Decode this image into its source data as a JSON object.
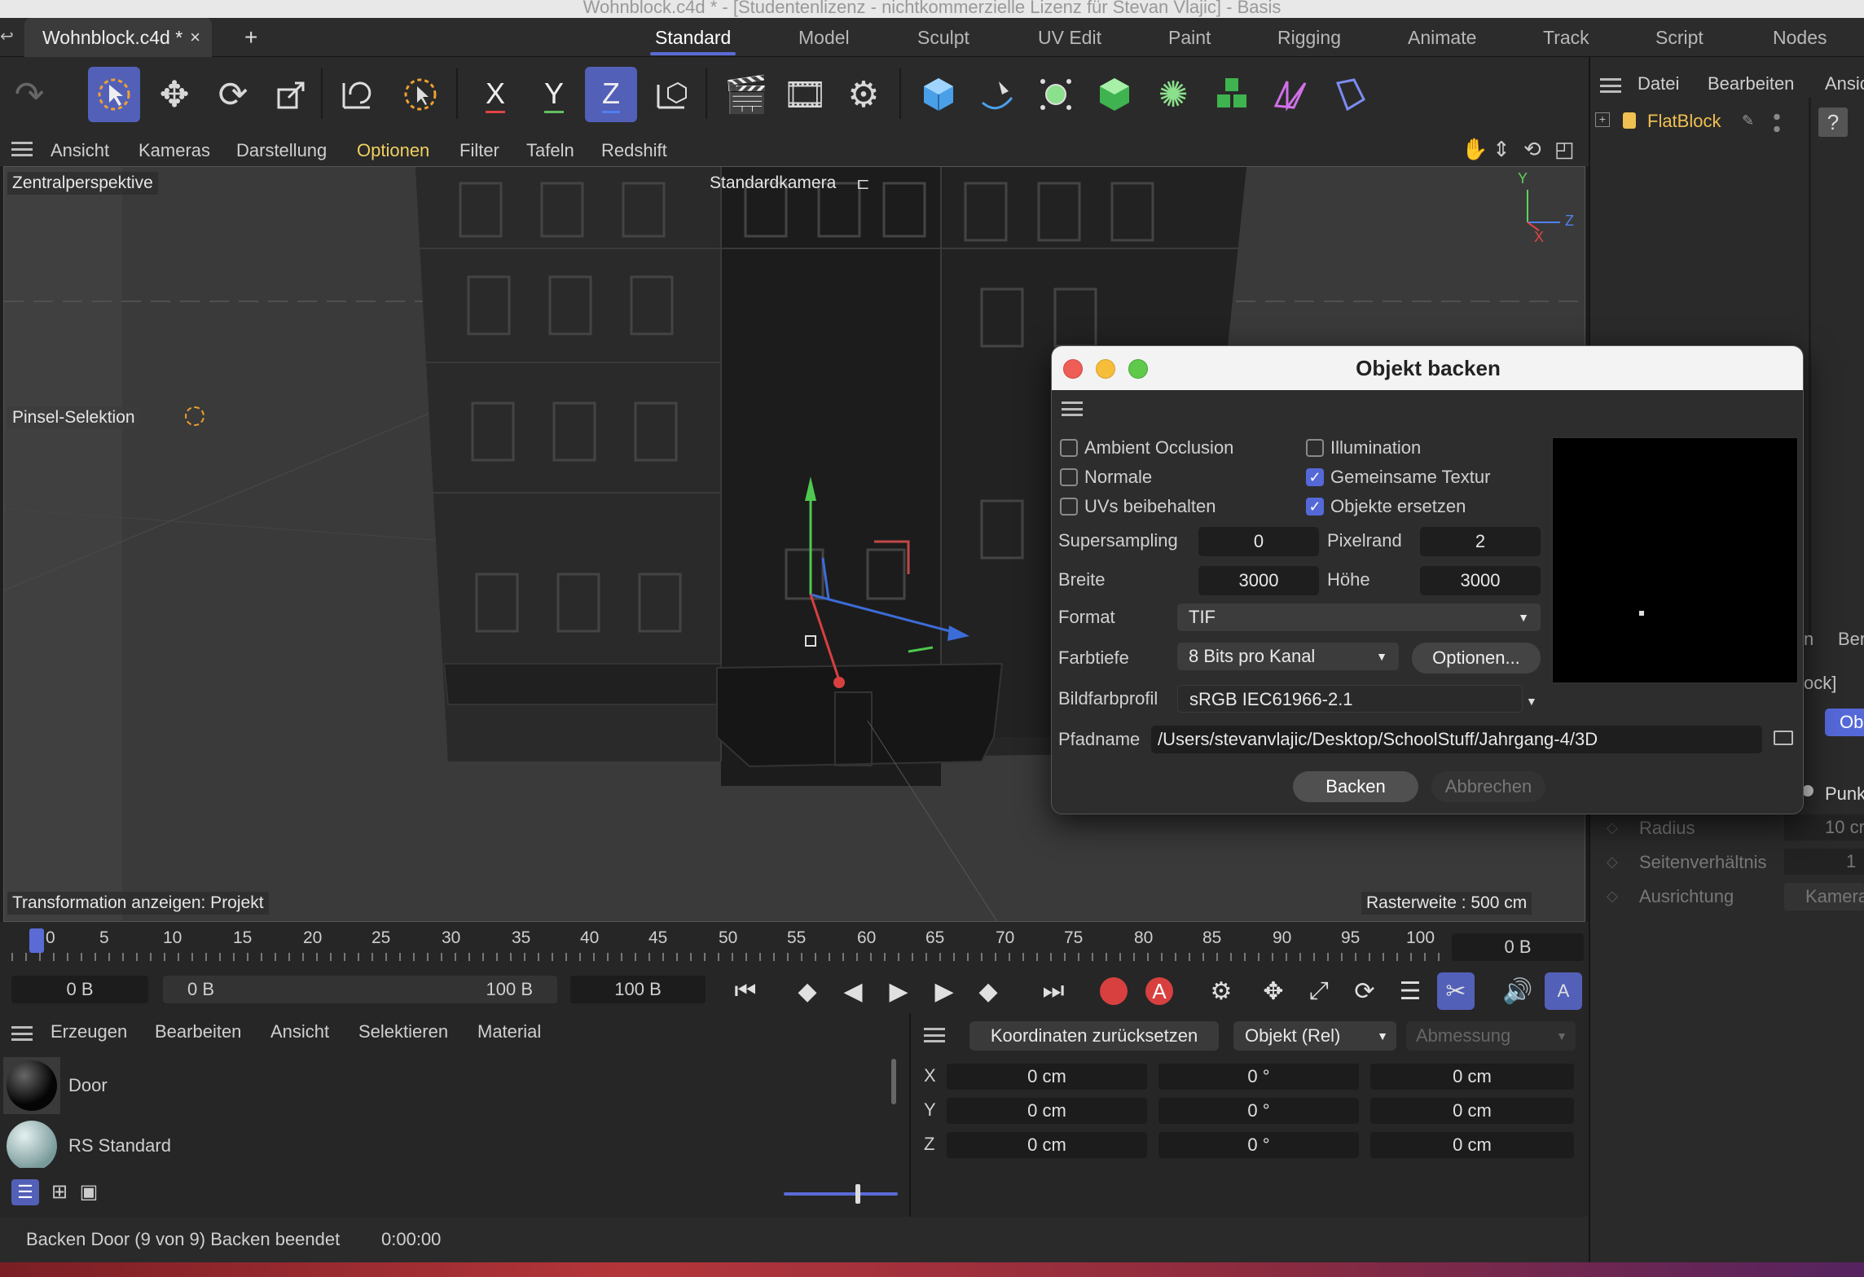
{
  "window": {
    "title": "Wohnblock.c4d * - [Studentenlizenz - nichtkommerzielle Lizenz für Stevan Vlajic] - Basis"
  },
  "doc_tab": {
    "label": "Wohnblock.c4d *",
    "close": "×",
    "new": "+"
  },
  "layouts": [
    "Standard",
    "Model",
    "Sculpt",
    "UV Edit",
    "Paint",
    "Rigging",
    "Animate",
    "Track",
    "Script",
    "Nodes"
  ],
  "active_layout": "Standard",
  "toolbar": {
    "axis_x": "X",
    "axis_y": "Y",
    "axis_z": "Z"
  },
  "viewport_menu": [
    "Ansicht",
    "Kameras",
    "Darstellung",
    "Optionen",
    "Filter",
    "Tafeln",
    "Redshift"
  ],
  "viewport": {
    "projection": "Zentralperspektive",
    "camera": "Standardkamera",
    "tool": "Pinsel-Selektion",
    "transform_info": "Transformation anzeigen: Projekt",
    "grid_info": "Rasterweite : 500 cm",
    "axis_x": "X",
    "axis_y": "Y",
    "axis_z": "Z"
  },
  "object_manager": {
    "menu": [
      "Datei",
      "Bearbeiten",
      "Ansic"
    ],
    "object": "FlatBlock",
    "help": "?"
  },
  "attr_partial": {
    "tab_n": "n",
    "tab_ber": "Ber",
    "title_partial": "ock]",
    "btn_ob": "Ob",
    "btn_punk": "Punk",
    "rows": [
      {
        "label": "Radius",
        "value": "10 cr"
      },
      {
        "label": "Seitenverhältnis",
        "value": "1"
      },
      {
        "label": "Ausrichtung",
        "value": "Kamera"
      }
    ]
  },
  "dialog": {
    "title": "Objekt backen",
    "checks": [
      {
        "label": "Ambient Occlusion",
        "checked": false
      },
      {
        "label": "Illumination",
        "checked": true
      },
      {
        "label": "Normale",
        "checked": false
      },
      {
        "label": "Gemeinsame Textur",
        "checked": true
      },
      {
        "label": "UVs beibehalten",
        "checked": false
      },
      {
        "label": "Objekte ersetzen",
        "checked": true
      }
    ],
    "supersampling_label": "Supersampling",
    "supersampling": "0",
    "pixelrand_label": "Pixelrand",
    "pixelrand": "2",
    "breite_label": "Breite",
    "breite": "3000",
    "hoehe_label": "Höhe",
    "hoehe": "3000",
    "format_label": "Format",
    "format": "TIF",
    "farbtiefe_label": "Farbtiefe",
    "farbtiefe": "8 Bits pro Kanal",
    "optionen": "Optionen...",
    "profil_label": "Bildfarbprofil",
    "profil": "sRGB IEC61966-2.1",
    "pfad_label": "Pfadname",
    "pfad": "/Users/stevanvlajic/Desktop/SchoolStuff/Jahrgang-4/3D",
    "backen": "Backen",
    "abbrechen": "Abbrechen"
  },
  "timeline": {
    "ticks": [
      "0",
      "5",
      "10",
      "15",
      "20",
      "25",
      "30",
      "35",
      "40",
      "45",
      "50",
      "55",
      "60",
      "65",
      "70",
      "75",
      "80",
      "85",
      "90",
      "95",
      "100"
    ],
    "current_frame": "0 B",
    "start": "0 B",
    "range_start": "0 B",
    "range_end": "100 B",
    "end": "100 B"
  },
  "material_manager": {
    "menu": [
      "Erzeugen",
      "Bearbeiten",
      "Ansicht",
      "Selektieren",
      "Material"
    ],
    "materials": [
      "Door",
      "RS Standard"
    ]
  },
  "coordinates": {
    "reset": "Koordinaten zurücksetzen",
    "mode": "Objekt (Rel)",
    "size_mode": "Abmessung",
    "rows": [
      {
        "axis": "X",
        "pos": "0 cm",
        "rot": "0 °",
        "size": "0 cm"
      },
      {
        "axis": "Y",
        "pos": "0 cm",
        "rot": "0 °",
        "size": "0 cm"
      },
      {
        "axis": "Z",
        "pos": "0 cm",
        "rot": "0 °",
        "size": "0 cm"
      }
    ]
  },
  "status": {
    "message": "Backen Door (9 von 9) Backen beendet",
    "time": "0:00:00"
  }
}
